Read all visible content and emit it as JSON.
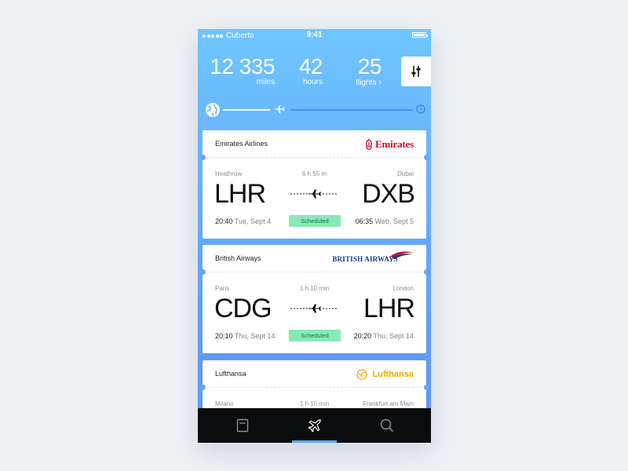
{
  "status_bar": {
    "carrier": "Cuberto",
    "time": "9:41"
  },
  "stats": {
    "miles": {
      "value": "12 335",
      "label": "miles"
    },
    "hours": {
      "value": "42",
      "label": "hours"
    },
    "flights": {
      "value": "25",
      "label": "flights"
    }
  },
  "icons": {
    "filter": "sliders-icon",
    "globe": "globe-icon",
    "plane": "airplane-icon",
    "progress_end": "clock-icon",
    "tab_book": "book-icon",
    "tab_plane": "airplane-icon",
    "tab_search": "search-icon",
    "chevron": "chevron-right-icon"
  },
  "colors": {
    "accent": "#5aa8f8",
    "scheduled_bg": "#88e9b6",
    "emirates": "#c8102e",
    "british_airways": "#13378f",
    "lufthansa": "#f5a800"
  },
  "flights": [
    {
      "airline": "Emirates Airlines",
      "logo_text": "Emirates",
      "from_city": "Heathrow",
      "from_code": "LHR",
      "to_city": "Dubai",
      "to_code": "DXB",
      "duration": "6 h 55 m",
      "dep_time": "20:40",
      "dep_date": "Tue, Sept 4",
      "arr_time": "06:35",
      "arr_date": "Web, Sept 5",
      "status": "Scheduled"
    },
    {
      "airline": "British Airways",
      "logo_text": "BRITISH AIRWAYS",
      "from_city": "Paris",
      "from_code": "CDG",
      "to_city": "London",
      "to_code": "LHR",
      "duration": "1 h 10 min",
      "dep_time": "20:10",
      "dep_date": "Thu, Sept 14",
      "arr_time": "20:20",
      "arr_date": "Thu, Sept 14",
      "status": "Scheduled"
    },
    {
      "airline": "Lufthansa",
      "logo_text": "Lufthansa",
      "from_city": "Milano",
      "to_city": "Frankfurt am Main",
      "duration": "1 h 15 min"
    }
  ]
}
